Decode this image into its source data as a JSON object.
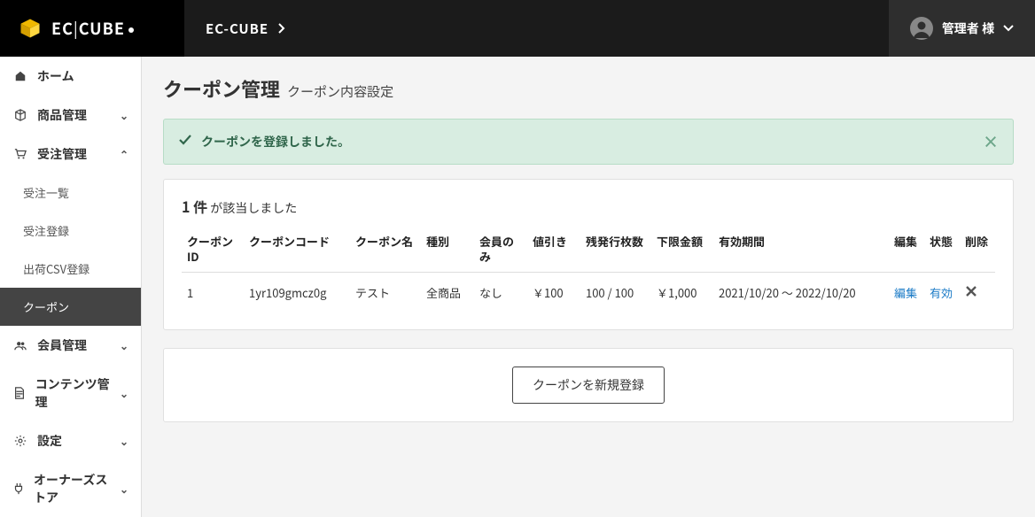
{
  "brand": {
    "left": "EC",
    "right": "CUBE"
  },
  "top": {
    "title": "EC-CUBE",
    "user": "管理者 様"
  },
  "sidebar": {
    "items": [
      {
        "label": "ホーム"
      },
      {
        "label": "商品管理"
      },
      {
        "label": "受注管理"
      },
      {
        "label": "受注一覧"
      },
      {
        "label": "受注登録"
      },
      {
        "label": "出荷CSV登録"
      },
      {
        "label": "クーポン"
      },
      {
        "label": "会員管理"
      },
      {
        "label": "コンテンツ管理"
      },
      {
        "label": "設定"
      },
      {
        "label": "オーナーズストア"
      }
    ]
  },
  "page": {
    "title": "クーポン管理",
    "subtitle": "クーポン内容設定"
  },
  "alert": {
    "message": "クーポンを登録しました。"
  },
  "result": {
    "count": "1 件",
    "suffix": " が該当しました"
  },
  "columns": {
    "id": "クーポンID",
    "code": "クーポンコード",
    "name": "クーポン名",
    "type": "種別",
    "member": "会員のみ",
    "discount": "値引き",
    "stock": "残発行枚数",
    "min": "下限金額",
    "period": "有効期間",
    "edit": "編集",
    "status": "状態",
    "delete": "削除"
  },
  "rows": [
    {
      "id": "1",
      "code": "1yr109gmcz0g",
      "name": "テスト",
      "type": "全商品",
      "member": "なし",
      "discount": "￥100",
      "stock": "100 / 100",
      "min": "￥1,000",
      "period": "2021/10/20 ～ 2022/10/20",
      "edit": "編集",
      "status": "有効",
      "delete": "×"
    }
  ],
  "button": {
    "new": "クーポンを新規登録"
  }
}
